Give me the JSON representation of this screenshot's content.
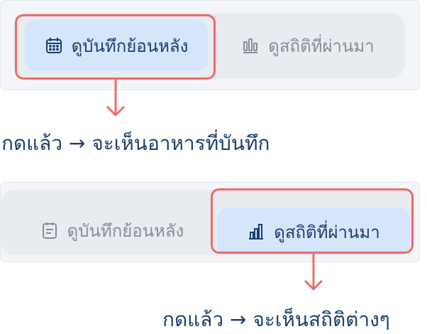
{
  "tab_labels": {
    "history": "ดูบันทึกย้อนหลัง",
    "stats": "ดูสถิติที่ผ่านมา"
  },
  "icons": {
    "history": "calendar-icon",
    "history_inactive": "clipboard-icon",
    "stats": "bar-chart-icon"
  },
  "steps": [
    {
      "active_tab": "history",
      "caption": "กดแล้ว → จะเห็นอาหารที่บันทึก"
    },
    {
      "active_tab": "stats",
      "caption": "กดแล้ว → จะเห็นสถิติต่างๆ"
    }
  ],
  "colors": {
    "active_bg": "#d5e5fa",
    "active_text": "#1b3f6e",
    "inactive_text": "#878d96",
    "highlight": "#ec6b6b",
    "panel_bg": "#f3f5f8",
    "track_bg": "#e8ebf0"
  }
}
